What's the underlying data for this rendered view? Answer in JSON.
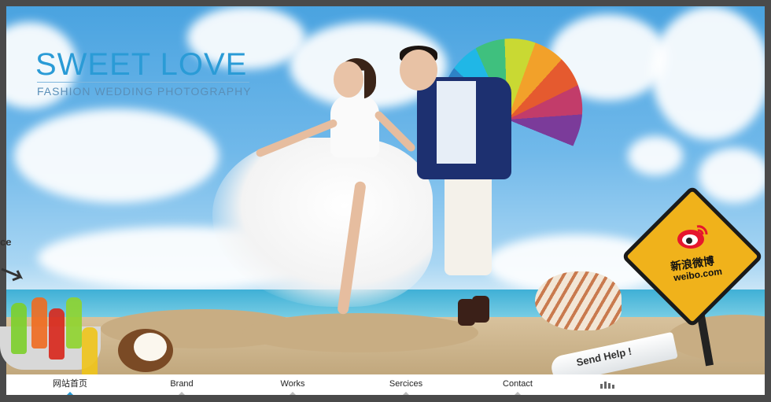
{
  "hero": {
    "title": "SWEET LOVE",
    "subtitle": "FASHION WEDDING PHOTOGRAPHY",
    "partial_left_text": "ce",
    "bottle_message": "Send Help !",
    "weibo_cn": "新浪微博",
    "weibo_en": "weibo.com",
    "colors": {
      "title": "#2a9bd6",
      "sign": "#f0b21b"
    }
  },
  "nav": {
    "items": [
      {
        "label": "网站首页",
        "active": true
      },
      {
        "label": "Brand"
      },
      {
        "label": "Works"
      },
      {
        "label": "Sercices"
      },
      {
        "label": "Contact"
      }
    ],
    "extra_icon": "bar-chart-icon"
  }
}
